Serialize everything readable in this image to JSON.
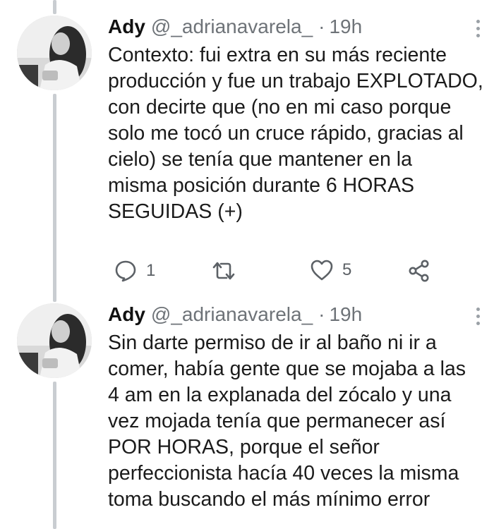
{
  "thread": [
    {
      "name": "Ady",
      "handle": "@_adrianavarela_",
      "separator": "·",
      "time": "19h",
      "text": "Contexto: fui extra en su más reciente\nproducción y fue un trabajo EXPLOTADO,\ncon decirte que (no en mi caso porque\nsolo me tocó un cruce rápido, gracias al\ncielo) se tenía que mantener en la\nmisma posición durante 6 HORAS\nSEGUIDAS (+)",
      "replies": "1",
      "retweets": "",
      "likes": "5",
      "icons": {
        "reply": "reply-icon",
        "retweet": "retweet-icon",
        "like": "like-icon",
        "share": "share-icon",
        "more": "more-options-icon"
      }
    },
    {
      "name": "Ady",
      "handle": "@_adrianavarela_",
      "separator": "·",
      "time": "19h",
      "text": "Sin darte permiso de ir al baño ni ir a\ncomer, había gente que se mojaba a las\n4 am en la explanada del zócalo y una\nvez mojada tenía que permanecer así\nPOR HORAS, porque el señor\nperfeccionista hacía 40 veces la misma\ntoma buscando el más mínimo error"
    }
  ],
  "colors": {
    "thread_line": "#c9cdd1",
    "muted_text": "#6e7378",
    "icon": "#5c6166"
  }
}
